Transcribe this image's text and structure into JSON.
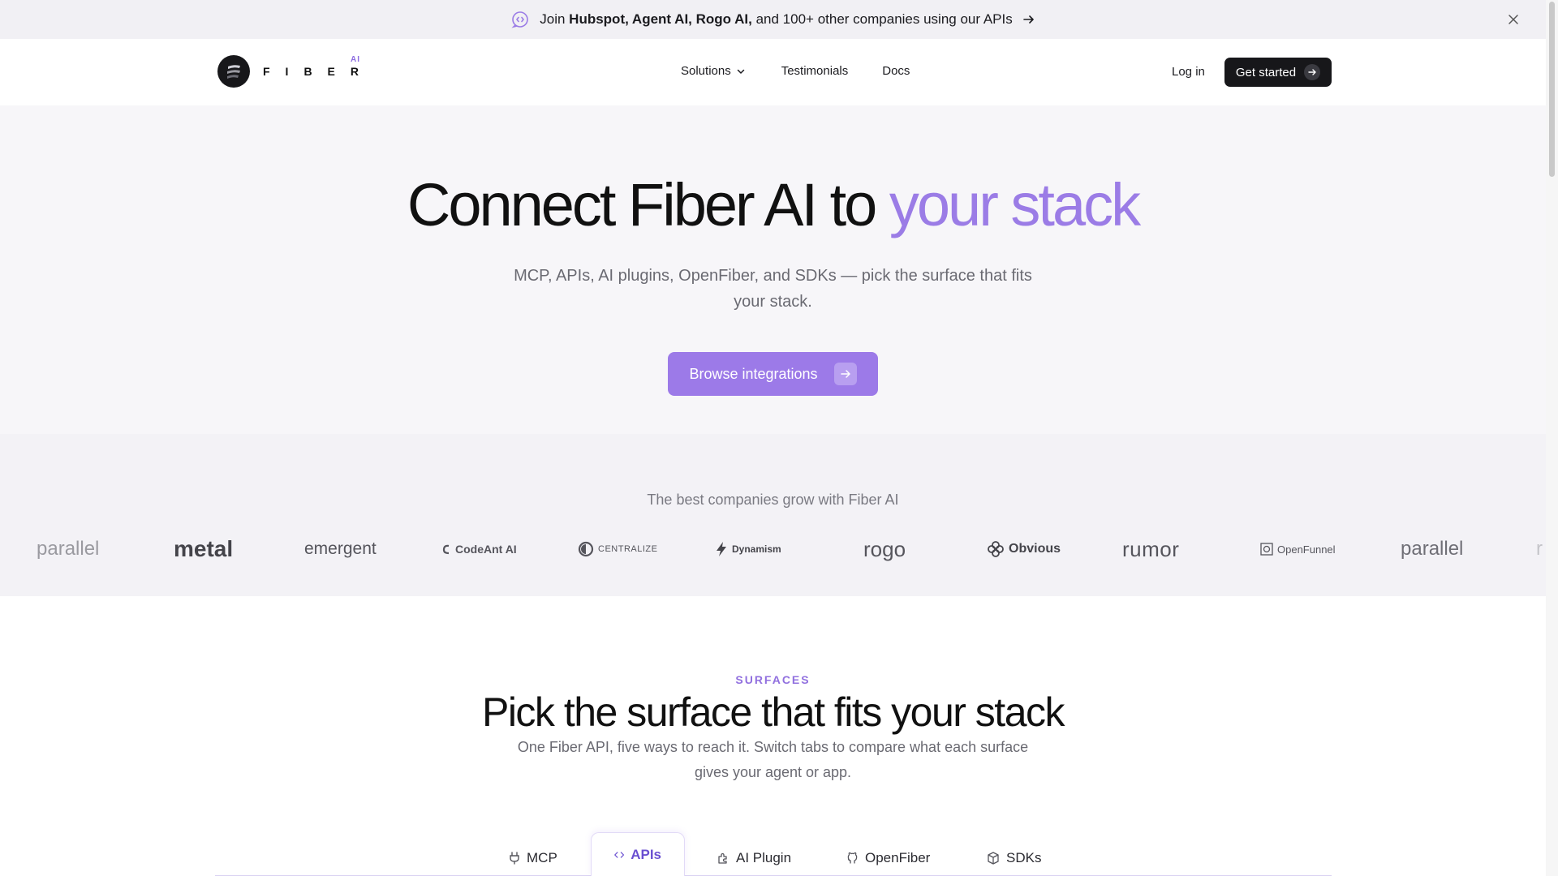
{
  "announcement": {
    "prefix": "Join ",
    "companies": "Hubspot, Agent AI, Rogo AI,",
    "suffix": " and 100+ other companies using our APIs"
  },
  "nav": {
    "logo_text": "FIBER",
    "logo_ai": "AI",
    "solutions": "Solutions",
    "testimonials": "Testimonials",
    "docs": "Docs",
    "login": "Log in",
    "get_started": "Get started"
  },
  "hero": {
    "title_main": "Connect Fiber AI to ",
    "title_accent": "your stack",
    "subtitle": "MCP, APIs, AI plugins, OpenFiber, and SDKs — pick the surface that fits your stack.",
    "cta": "Browse integrations"
  },
  "logos": {
    "caption": "The best companies grow with Fiber AI",
    "brands": [
      "parallel",
      "metal",
      "emergent",
      "CodeAnt AI",
      "CENTRALIZE",
      "Dynamism",
      "rogo",
      "Obvious",
      "rumor",
      "OpenFunnel",
      "parallel",
      "r"
    ]
  },
  "surfaces": {
    "eyebrow": "SURFACES",
    "title": "Pick the surface that fits your stack",
    "subtitle": "One Fiber API, five ways to reach it. Switch tabs to compare what each surface gives your agent or app.",
    "tabs": [
      {
        "label": "MCP",
        "icon": "plug-icon"
      },
      {
        "label": "APIs",
        "icon": "code-icon",
        "active": true
      },
      {
        "label": "AI Plugin",
        "icon": "puzzle-icon"
      },
      {
        "label": "OpenFiber",
        "icon": "github-icon"
      },
      {
        "label": "SDKs",
        "icon": "package-icon"
      }
    ]
  },
  "colors": {
    "accent": "#9b7ce6",
    "dark": "#17171a"
  }
}
